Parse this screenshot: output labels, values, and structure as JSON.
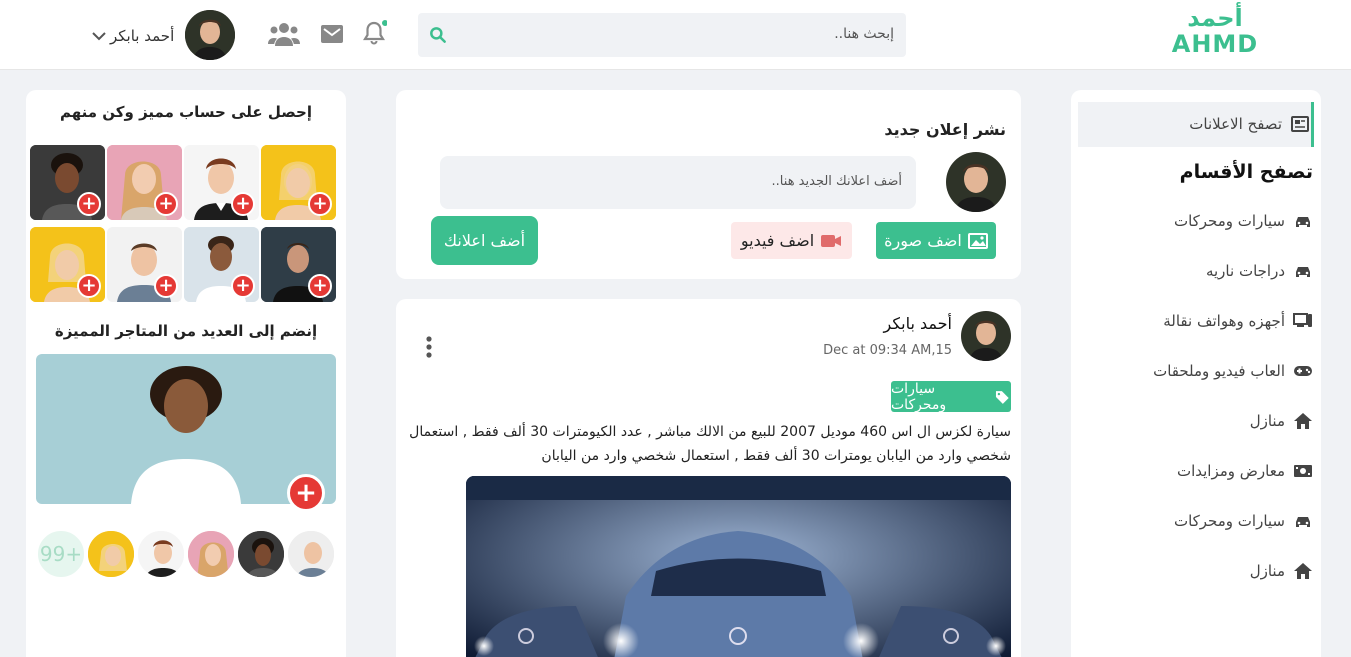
{
  "header": {
    "logo_ar": "أحمد",
    "logo_en": "AHMD",
    "search_placeholder": "إبحث هنا..",
    "user_name": "أحمد بابكر"
  },
  "sidebar": {
    "browse_ads": "تصفح الاعلانات",
    "categories_title": "تصفح الأقسام",
    "items": [
      {
        "label": "سيارات ومحركات",
        "icon": "car-icon"
      },
      {
        "label": "دراجات ناريه",
        "icon": "car-icon"
      },
      {
        "label": "أجهزه وهواتف نقالة",
        "icon": "devices-icon"
      },
      {
        "label": "العاب فيديو وملحقات",
        "icon": "gamepad-icon"
      },
      {
        "label": "منازل",
        "icon": "home-icon"
      },
      {
        "label": "معارض ومزايدات",
        "icon": "money-icon"
      },
      {
        "label": "سيارات ومحركات",
        "icon": "car-icon"
      },
      {
        "label": "منازل",
        "icon": "home-icon"
      }
    ]
  },
  "composer": {
    "title": "نشر إعلان جديد",
    "placeholder": "أضف اعلانك الجديد هنا..",
    "add_photo": "اضف صورة",
    "add_video": "اضف فيديو",
    "submit": "أضف اعلانك"
  },
  "post": {
    "author": "أحمد بابكر",
    "time": "Dec at 09:34 AM,15",
    "tag": "سيارات ومحركات",
    "text": "سيارة لكزس ال اس 460 موديل 2007 للبيع من الالك مباشر , عدد الكيومترات 30 ألف فقط , استعمال شخصي وارد من اليابان يومترات 30 ألف فقط , استعمال شخصي وارد من اليابان"
  },
  "promo": {
    "title": "إحصل على حساب مميز وكن منهم",
    "join_title": "إنضم إلى العديد من المتاجر المميزة",
    "more_count": "99+"
  },
  "colors": {
    "accent": "#3cbf8f",
    "red": "#e53935",
    "bg": "#f0f2f5"
  }
}
